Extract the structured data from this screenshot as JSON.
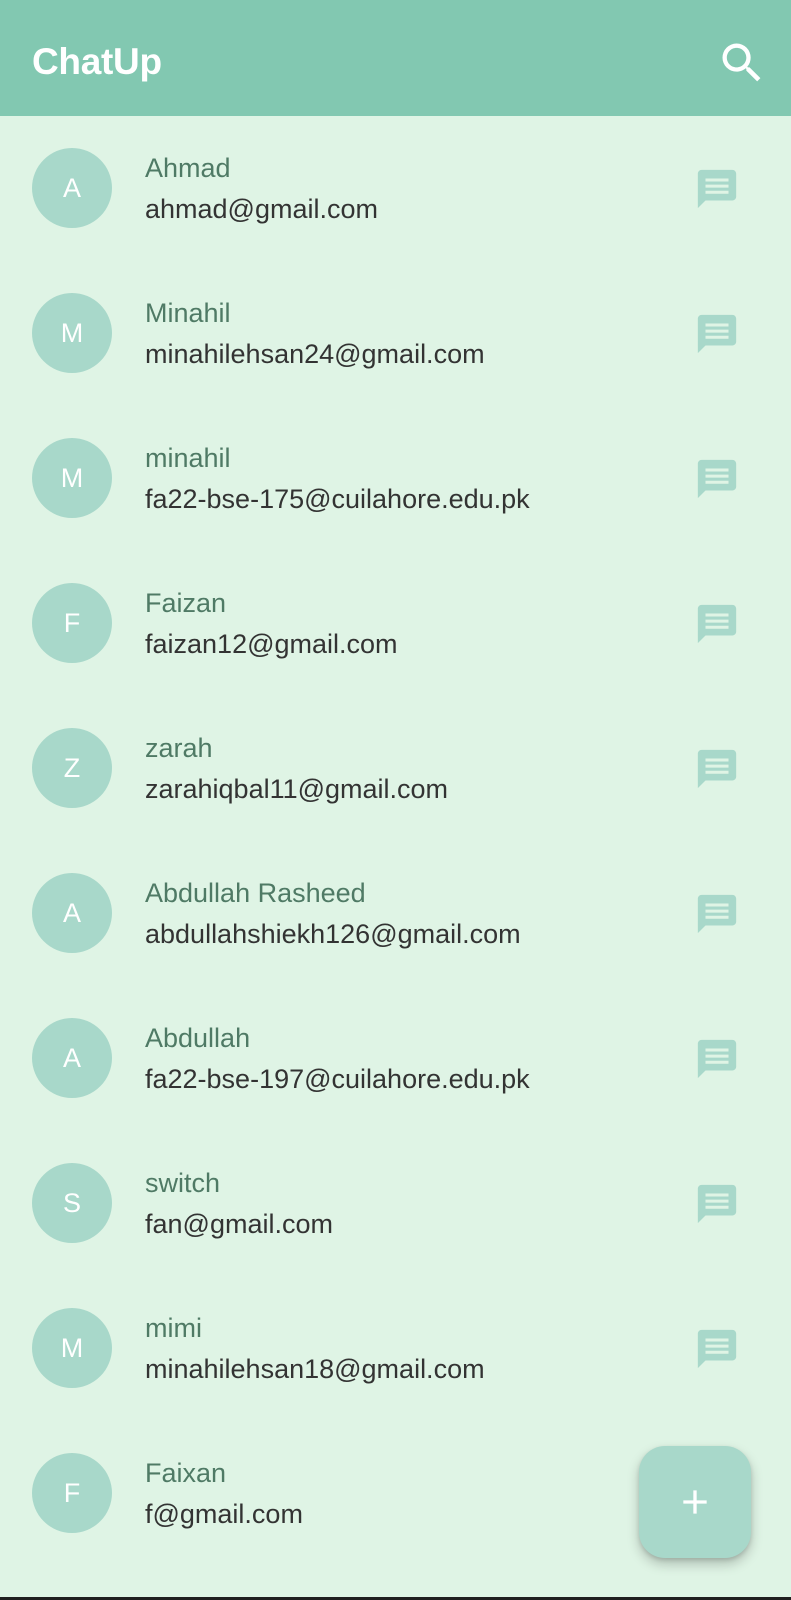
{
  "app": {
    "title": "ChatUp",
    "search_icon": "search-icon",
    "accent_color": "#82C8B1",
    "background_color": "#DFF4E5",
    "avatar_color": "#A8D8CA"
  },
  "contacts": [
    {
      "initial": "A",
      "name": "Ahmad",
      "email": "ahmad@gmail.com",
      "action_icon": "message-icon"
    },
    {
      "initial": "M",
      "name": "Minahil",
      "email": "minahilehsan24@gmail.com",
      "action_icon": "message-icon"
    },
    {
      "initial": "M",
      "name": "minahil",
      "email": "fa22-bse-175@cuilahore.edu.pk",
      "action_icon": "message-icon"
    },
    {
      "initial": "F",
      "name": "Faizan",
      "email": "faizan12@gmail.com",
      "action_icon": "message-icon"
    },
    {
      "initial": "Z",
      "name": "zarah",
      "email": "zarahiqbal11@gmail.com",
      "action_icon": "message-icon"
    },
    {
      "initial": "A",
      "name": "Abdullah Rasheed",
      "email": "abdullahshiekh126@gmail.com",
      "action_icon": "message-icon"
    },
    {
      "initial": "A",
      "name": "Abdullah",
      "email": "fa22-bse-197@cuilahore.edu.pk",
      "action_icon": "message-icon"
    },
    {
      "initial": "S",
      "name": "switch",
      "email": "fan@gmail.com",
      "action_icon": "message-icon"
    },
    {
      "initial": "M",
      "name": "mimi",
      "email": "minahilehsan18@gmail.com",
      "action_icon": "message-icon"
    },
    {
      "initial": "F",
      "name": "Faixan",
      "email": "f@gmail.com",
      "action_icon": "message-icon"
    }
  ],
  "fab": {
    "icon": "plus-icon"
  }
}
